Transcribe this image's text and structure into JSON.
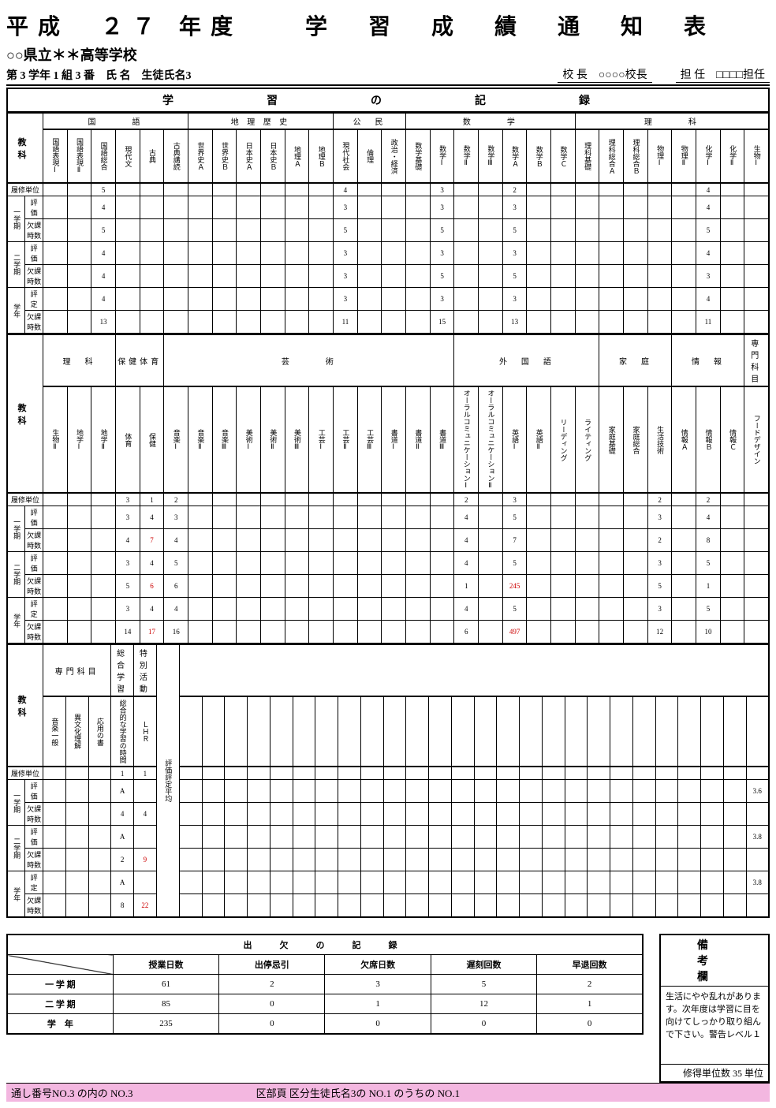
{
  "header": {
    "title": "平成　２７ 年度　　学　習　成　績　通　知　表",
    "school": "○○県立＊＊高等学校",
    "student": "第 3 学年 1 組 3 番　氏 名　生徒氏名3",
    "principal_l": "校 長",
    "principal_v": "○○○○校長",
    "teacher_l": "担 任",
    "teacher_v": "□□□□担任"
  },
  "section1": "学　　習　　の　　記　　録",
  "labels": {
    "kyoka": "教　　科",
    "kamoku": "科　目",
    "risyu": "履修単位",
    "t1g": "一学期",
    "t2g": "二学期",
    "yg": "学年",
    "hyo": "評　価",
    "hyote": "評　定",
    "kesseki": "欠課時数",
    "avg": "評価評定平均"
  },
  "group1": {
    "hdr": [
      "国　　　語",
      "地 理 歴 史",
      "公　民",
      "数　　　学",
      "理　　　科"
    ],
    "cols": [
      "国語表現Ⅰ",
      "国語表現Ⅱ",
      "国語総合",
      "現代文",
      "古典",
      "古典講読",
      "世界史Ａ",
      "世界史Ｂ",
      "日本史Ａ",
      "日本史Ｂ",
      "地理Ａ",
      "地理Ｂ",
      "現代社会",
      "倫理",
      "政治・経済",
      "数学基礎",
      "数学Ⅰ",
      "数学Ⅱ",
      "数学Ⅲ",
      "数学Ａ",
      "数学Ｂ",
      "数学Ｃ",
      "理科基礎",
      "理科総合Ａ",
      "理科総合Ｂ",
      "物理Ⅰ",
      "物理Ⅱ",
      "化学Ⅰ",
      "化学Ⅱ",
      "生物Ⅰ"
    ],
    "risyu": [
      "",
      "",
      "5",
      "",
      "",
      "",
      "",
      "",
      "",
      "",
      "",
      "",
      "4",
      "",
      "",
      "",
      "3",
      "",
      "",
      "2",
      "",
      "",
      "",
      "",
      "",
      "",
      "",
      "4",
      "",
      ""
    ],
    "t1h": [
      "",
      "",
      "4",
      "",
      "",
      "",
      "",
      "",
      "",
      "",
      "",
      "",
      "3",
      "",
      "",
      "",
      "3",
      "",
      "",
      "3",
      "",
      "",
      "",
      "",
      "",
      "",
      "",
      "4",
      "",
      ""
    ],
    "t1k": [
      "",
      "",
      "5",
      "",
      "",
      "",
      "",
      "",
      "",
      "",
      "",
      "",
      "5",
      "",
      "",
      "",
      "5",
      "",
      "",
      "5",
      "",
      "",
      "",
      "",
      "",
      "",
      "",
      "5",
      "",
      ""
    ],
    "t2h": [
      "",
      "",
      "4",
      "",
      "",
      "",
      "",
      "",
      "",
      "",
      "",
      "",
      "3",
      "",
      "",
      "",
      "3",
      "",
      "",
      "3",
      "",
      "",
      "",
      "",
      "",
      "",
      "",
      "4",
      "",
      ""
    ],
    "t2k": [
      "",
      "",
      "4",
      "",
      "",
      "",
      "",
      "",
      "",
      "",
      "",
      "",
      "3",
      "",
      "",
      "",
      "5",
      "",
      "",
      "5",
      "",
      "",
      "",
      "",
      "",
      "",
      "",
      "3",
      "",
      ""
    ],
    "yh": [
      "",
      "",
      "4",
      "",
      "",
      "",
      "",
      "",
      "",
      "",
      "",
      "",
      "3",
      "",
      "",
      "",
      "3",
      "",
      "",
      "3",
      "",
      "",
      "",
      "",
      "",
      "",
      "",
      "4",
      "",
      ""
    ],
    "yk": [
      "",
      "",
      "13",
      "",
      "",
      "",
      "",
      "",
      "",
      "",
      "",
      "",
      "11",
      "",
      "",
      "",
      "15",
      "",
      "",
      "13",
      "",
      "",
      "",
      "",
      "",
      "",
      "",
      "11",
      "",
      ""
    ],
    "red": []
  },
  "group2": {
    "hdr": [
      "理　科",
      "保健体育",
      "芸　　　術",
      "外　国　語",
      "家　庭",
      "情　報",
      "専門科目"
    ],
    "cols": [
      "生物Ⅱ",
      "地学Ⅰ",
      "地学Ⅱ",
      "体育",
      "保健",
      "音楽Ⅰ",
      "音楽Ⅱ",
      "音楽Ⅲ",
      "美術Ⅰ",
      "美術Ⅱ",
      "美術Ⅲ",
      "工芸Ⅰ",
      "工芸Ⅱ",
      "工芸Ⅲ",
      "書道Ⅰ",
      "書道Ⅱ",
      "書道Ⅲ",
      "オーラルコミュニケーションⅠ",
      "オーラルコミュニケーションⅡ",
      "英語Ⅰ",
      "英語Ⅱ",
      "リーディング",
      "ライティング",
      "家庭基礎",
      "家庭総合",
      "生活技術",
      "情報Ａ",
      "情報Ｂ",
      "情報Ｃ",
      "フードデザイン"
    ],
    "risyu": [
      "",
      "",
      "",
      "3",
      "1",
      "2",
      "",
      "",
      "",
      "",
      "",
      "",
      "",
      "",
      "",
      "",
      "",
      "2",
      "",
      "3",
      "",
      "",
      "",
      "",
      "",
      "2",
      "",
      "2",
      "",
      ""
    ],
    "t1h": [
      "",
      "",
      "",
      "3",
      "4",
      "3",
      "",
      "",
      "",
      "",
      "",
      "",
      "",
      "",
      "",
      "",
      "",
      "4",
      "",
      "5",
      "",
      "",
      "",
      "",
      "",
      "3",
      "",
      "4",
      "",
      ""
    ],
    "t1k": [
      "",
      "",
      "",
      "4",
      "7",
      "4",
      "",
      "",
      "",
      "",
      "",
      "",
      "",
      "",
      "",
      "",
      "",
      "4",
      "",
      "7",
      "",
      "",
      "",
      "",
      "",
      "2",
      "",
      "8",
      "",
      ""
    ],
    "t2h": [
      "",
      "",
      "",
      "3",
      "4",
      "5",
      "",
      "",
      "",
      "",
      "",
      "",
      "",
      "",
      "",
      "",
      "",
      "4",
      "",
      "5",
      "",
      "",
      "",
      "",
      "",
      "3",
      "",
      "5",
      "",
      ""
    ],
    "t2k": [
      "",
      "",
      "",
      "5",
      "6",
      "6",
      "",
      "",
      "",
      "",
      "",
      "",
      "",
      "",
      "",
      "",
      "",
      "1",
      "",
      "245",
      "",
      "",
      "",
      "",
      "",
      "5",
      "",
      "1",
      "",
      ""
    ],
    "yh": [
      "",
      "",
      "",
      "3",
      "4",
      "4",
      "",
      "",
      "",
      "",
      "",
      "",
      "",
      "",
      "",
      "",
      "",
      "4",
      "",
      "5",
      "",
      "",
      "",
      "",
      "",
      "3",
      "",
      "5",
      "",
      ""
    ],
    "yk": [
      "",
      "",
      "",
      "14",
      "17",
      "16",
      "",
      "",
      "",
      "",
      "",
      "",
      "",
      "",
      "",
      "",
      "",
      "6",
      "",
      "497",
      "",
      "",
      "",
      "",
      "",
      "12",
      "",
      "10",
      "",
      ""
    ],
    "red": [
      "1,4",
      "3,4",
      "5,4",
      "3,19",
      "5,19"
    ]
  },
  "group3": {
    "hdr": [
      "専門科目",
      "総合学習",
      "特別活動"
    ],
    "cols": [
      "音楽一般",
      "異文化理解",
      "応用の書",
      "総合的な学習の時間",
      "ＬＨＲ"
    ],
    "risyu": [
      "",
      "",
      "",
      "1",
      "1"
    ],
    "t1h": [
      "",
      "",
      "",
      "A",
      ""
    ],
    "t1k": [
      "",
      "",
      "",
      "4",
      "4"
    ],
    "t2h": [
      "",
      "",
      "",
      "A",
      ""
    ],
    "t2k": [
      "",
      "",
      "",
      "2",
      "9"
    ],
    "yh": [
      "",
      "",
      "",
      "A",
      ""
    ],
    "yk": [
      "",
      "",
      "",
      "8",
      "22"
    ],
    "avg": {
      "t1": "3.6",
      "t2": "3.8",
      "y": "3.8"
    },
    "red": [
      "3,4",
      "5,4"
    ]
  },
  "attendance": {
    "title": "出　欠　の　記　録",
    "cols": [
      "授業日数",
      "出停忌引",
      "欠席日数",
      "遅刻回数",
      "早退回数"
    ],
    "rows": [
      {
        "l": "一 学 期",
        "v": [
          "61",
          "2",
          "3",
          "5",
          "2"
        ]
      },
      {
        "l": "二 学 期",
        "v": [
          "85",
          "0",
          "1",
          "12",
          "1"
        ]
      },
      {
        "l": "学　年",
        "v": [
          "235",
          "0",
          "0",
          "0",
          "0"
        ]
      }
    ]
  },
  "remarks": {
    "title": "備　　考　　欄",
    "body": "生活にやや乱れがあります。次年度は学習に目を向けてしっかり取り組んで下さい。警告レベル１",
    "credits": "修得単位数 35 単位"
  },
  "footer": {
    "l": "通し番号NO.3 の内の NO.3",
    "r": "区部頁 区分生徒氏名3の NO.1 のうちの NO.1"
  }
}
